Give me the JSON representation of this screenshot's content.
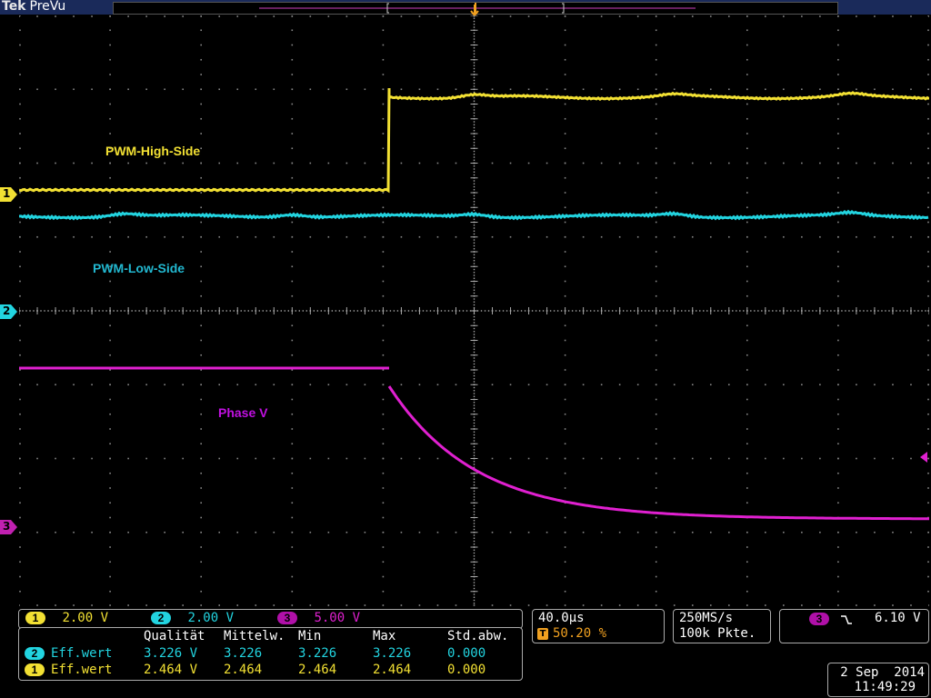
{
  "header": {
    "brand": "Tek",
    "mode": "PreVu"
  },
  "trigger_marker": "T",
  "channel_markers": [
    "1",
    "2",
    "3"
  ],
  "trace_labels": {
    "ch1": "PWM-High-Side",
    "ch2": "PWM-Low-Side",
    "ch3": "Phase V"
  },
  "channels": [
    {
      "id": "1",
      "scale": "2.00 V",
      "color": "#f2e033"
    },
    {
      "id": "2",
      "scale": "2.00 V",
      "color": "#22d4e0"
    },
    {
      "id": "3",
      "scale": "5.00 V",
      "color": "#e020d0"
    }
  ],
  "timebase": {
    "time_per_div": "40.0µs",
    "trigger_badge": "T",
    "trigger_position": "50.20 %"
  },
  "acquisition": {
    "sample_rate": "250MS/s",
    "record_length": "100k Pkte."
  },
  "trigger": {
    "source": "3",
    "slope_icon": "falling-edge-icon",
    "level": "6.10 V"
  },
  "measurements": {
    "headers": [
      "Qualität",
      "Mittelw.",
      "Min",
      "Max",
      "Std.abw."
    ],
    "rows": [
      {
        "channel": "2",
        "name": "Eff.wert",
        "values": [
          "3.226 V",
          "3.226",
          "3.226",
          "3.226",
          "0.000"
        ]
      },
      {
        "channel": "1",
        "name": "Eff.wert",
        "values": [
          "2.464 V",
          "2.464",
          "2.464",
          "2.464",
          "0.000"
        ]
      }
    ]
  },
  "datetime": {
    "date": "2 Sep  2014",
    "time": "11:49:29"
  },
  "colors": {
    "ch1": "#f2e033",
    "ch2": "#22d4e0",
    "ch3": "#e020d0",
    "trigger": "#f0a020",
    "grid": "#888888"
  }
}
